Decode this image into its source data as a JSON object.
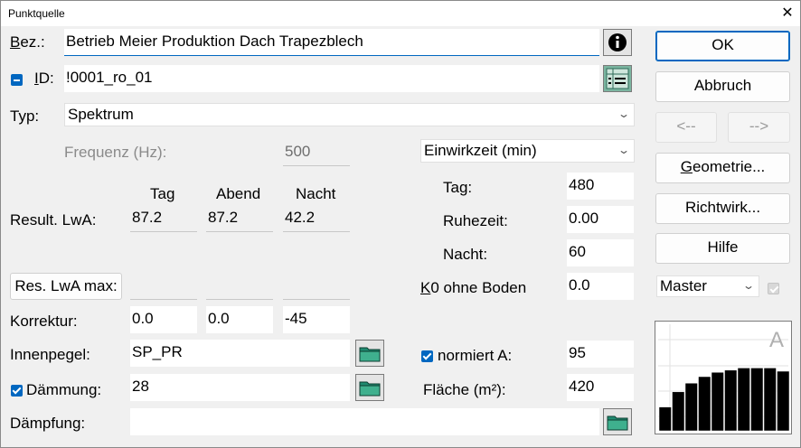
{
  "window": {
    "title": "Punktquelle",
    "close_glyph": "✕"
  },
  "bez": {
    "label_prefix": "",
    "label_u": "B",
    "label_rest": "ez.:",
    "value": "Betrieb Meier Produktion Dach Trapezblech",
    "info_icon": "info-icon"
  },
  "id": {
    "label_u": "I",
    "label_rest": "D:",
    "value": "!0001_ro_01",
    "checked": "indeterminate"
  },
  "typ": {
    "label": "Typ:",
    "value": "Spektrum"
  },
  "frequenz": {
    "label": "Frequenz (Hz):",
    "value": "500"
  },
  "einwirkzeit": {
    "select": "Einwirkzeit (min)",
    "tag_label": "Tag:",
    "tag_value": "480",
    "ruhe_label": "Ruhezeit:",
    "ruhe_value": "0.00",
    "nacht_label": "Nacht:",
    "nacht_value": "60"
  },
  "columns": {
    "tag": "Tag",
    "abend": "Abend",
    "nacht": "Nacht"
  },
  "result": {
    "label": "Result. LwA:",
    "tag": "87.2",
    "abend": "87.2",
    "nacht": "42.2"
  },
  "resmax": {
    "button": "Res. LwA max:",
    "tag": "",
    "abend": "",
    "nacht": ""
  },
  "k0": {
    "label_u": "K",
    "label_rest": "0 ohne Boden",
    "value": "0.0"
  },
  "korrektur": {
    "label": "Korrektur:",
    "tag": "0.0",
    "abend": "0.0",
    "nacht": "-45"
  },
  "innenpegel": {
    "label": "Innenpegel:",
    "value": "SP_PR"
  },
  "normiert": {
    "label": "normiert A:",
    "value": "95",
    "checked": true
  },
  "daemmung": {
    "label": "Dämmung:",
    "value": "28",
    "checked": true
  },
  "flaeche": {
    "label": "Fläche (m²):",
    "value": "420"
  },
  "daempfung": {
    "label": "Dämpfung:",
    "value": ""
  },
  "buttons": {
    "ok": "OK",
    "abbruch": "Abbruch",
    "prev": "<--",
    "next": "-->",
    "geometrie_u": "G",
    "geometrie_rest": "eometrie...",
    "richtwirk": "Richtwirk...",
    "hilfe": "Hilfe"
  },
  "master": {
    "value": "Master"
  },
  "spectrum": {
    "weighting_letter": "A",
    "bar_color": "#000000",
    "levels": [
      0.22,
      0.36,
      0.44,
      0.5,
      0.54,
      0.56,
      0.58,
      0.58,
      0.58,
      0.55
    ]
  },
  "colors": {
    "accent": "#0067c0",
    "dialog_bg": "#f0f0f0",
    "folder": "#1f8a70"
  }
}
